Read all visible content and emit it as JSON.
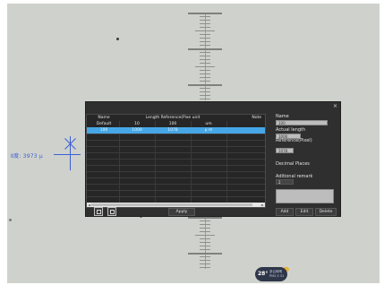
{
  "measurement_overlay": {
    "label": "Ⅱ度: 3973 μ"
  },
  "dialog": {
    "close_glyph": "×",
    "table": {
      "headers": [
        "Name",
        "Length Reference(Pixe unit",
        "",
        "",
        "Note"
      ],
      "rows": [
        [
          "Default",
          "10",
          "100",
          "um",
          ""
        ],
        [
          "100",
          "1000",
          "1078",
          "μ m",
          ""
        ]
      ],
      "selected_row": 1,
      "scroll_left": "◄",
      "scroll_right": "►"
    },
    "form": {
      "name_label": "Name",
      "name_value": "100",
      "actual_length_label": "Actual length",
      "actual_length_value": "1000",
      "reference_label": "Reference(Pixel)",
      "reference_value": "1078",
      "decimal_places_label": "Decimal Places",
      "decimal_places_value": "2",
      "remark_label": "Aditional remark"
    },
    "buttons": {
      "apply": "Apply",
      "add": "Add",
      "edit": "Edit",
      "delete": "Delete"
    },
    "icons": [
      "export-icon",
      "import-icon"
    ]
  },
  "status_badge": {
    "temperature": "28°",
    "line1": "多云转晴",
    "line2": "PM2.5 31"
  },
  "colors": {
    "viewer_background": "#cfd2cc",
    "dialog_background": "#2f2f2f",
    "selection": "#47a7e6",
    "measure_line": "#3c5fd6"
  }
}
